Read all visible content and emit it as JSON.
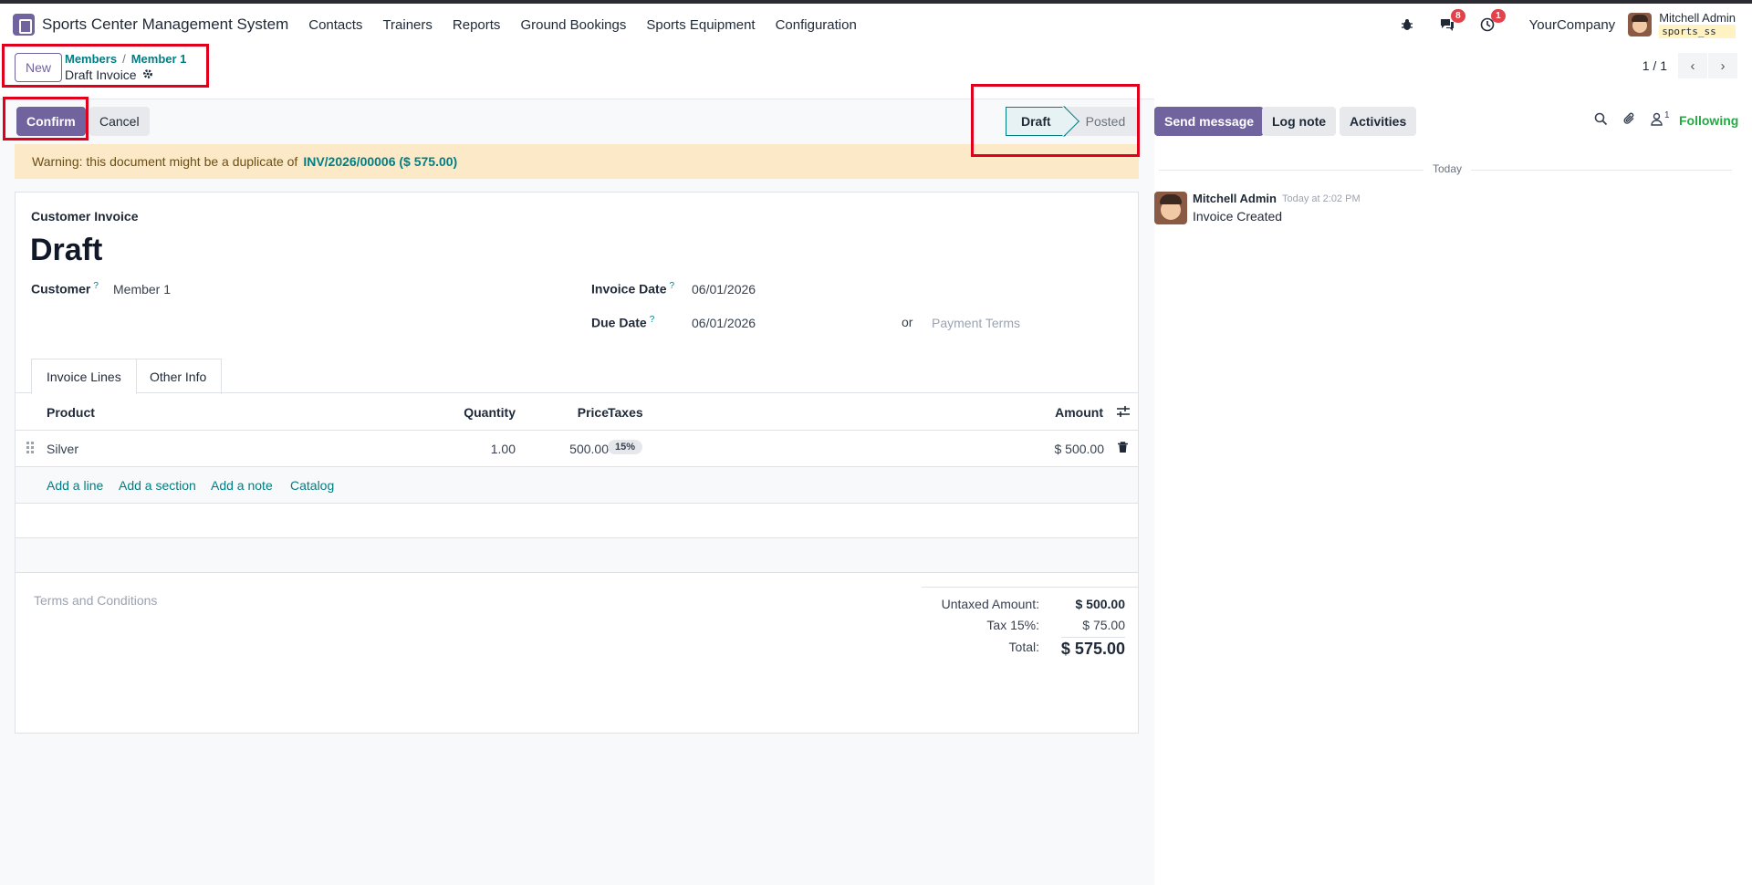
{
  "navbar": {
    "app_name": "Sports Center Management System",
    "menu": [
      "Contacts",
      "Trainers",
      "Reports",
      "Ground Bookings",
      "Sports Equipment",
      "Configuration"
    ],
    "messages_count": "8",
    "activities_count": "1",
    "company": "YourCompany",
    "user_name": "Mitchell Admin",
    "database": "sports_ss"
  },
  "control": {
    "new_label": "New",
    "breadcrumb": [
      "Members",
      "Member 1"
    ],
    "breadcrumb_sep": "/",
    "current": "Draft Invoice",
    "pager": "1 / 1"
  },
  "actions": {
    "confirm": "Confirm",
    "cancel": "Cancel"
  },
  "statusbar": {
    "stages": [
      "Draft",
      "Posted"
    ],
    "active": "Draft"
  },
  "warning": {
    "text": "Warning: this document might be a duplicate of",
    "link": "INV/2026/00006 ($ 575.00)"
  },
  "invoice": {
    "type": "Customer Invoice",
    "state": "Draft",
    "customer_label": "Customer",
    "customer": "Member 1",
    "invoice_date_label": "Invoice Date",
    "invoice_date": "06/01/2026",
    "due_date_label": "Due Date",
    "due_date": "06/01/2026",
    "or": "or",
    "payment_terms_placeholder": "Payment Terms",
    "help_mark": "?"
  },
  "tabs": [
    "Invoice Lines",
    "Other Info"
  ],
  "lines": {
    "columns": [
      "Product",
      "Quantity",
      "Price",
      "Taxes",
      "Amount"
    ],
    "rows": [
      {
        "product": "Silver",
        "quantity": "1.00",
        "price": "500.00",
        "tax": "15%",
        "amount": "$ 500.00"
      }
    ],
    "add_links": [
      "Add a line",
      "Add a section",
      "Add a note",
      "Catalog"
    ]
  },
  "footer": {
    "terms_placeholder": "Terms and Conditions",
    "untaxed_label": "Untaxed Amount:",
    "untaxed": "$ 500.00",
    "tax_label": "Tax 15%:",
    "tax": "$ 75.00",
    "total_label": "Total:",
    "total": "$ 575.00"
  },
  "chatter": {
    "send_message": "Send message",
    "log_note": "Log note",
    "activities": "Activities",
    "followers_count": "1",
    "following": "Following",
    "date_separator": "Today",
    "messages": [
      {
        "author": "Mitchell Admin",
        "time": "Today at 2:02 PM",
        "body": "Invoice Created"
      }
    ]
  },
  "colors": {
    "brand": "#71639e",
    "link": "#017e84",
    "highlight": "#e0001b",
    "warning_bg": "#fbe9c7",
    "following": "#28a745"
  }
}
